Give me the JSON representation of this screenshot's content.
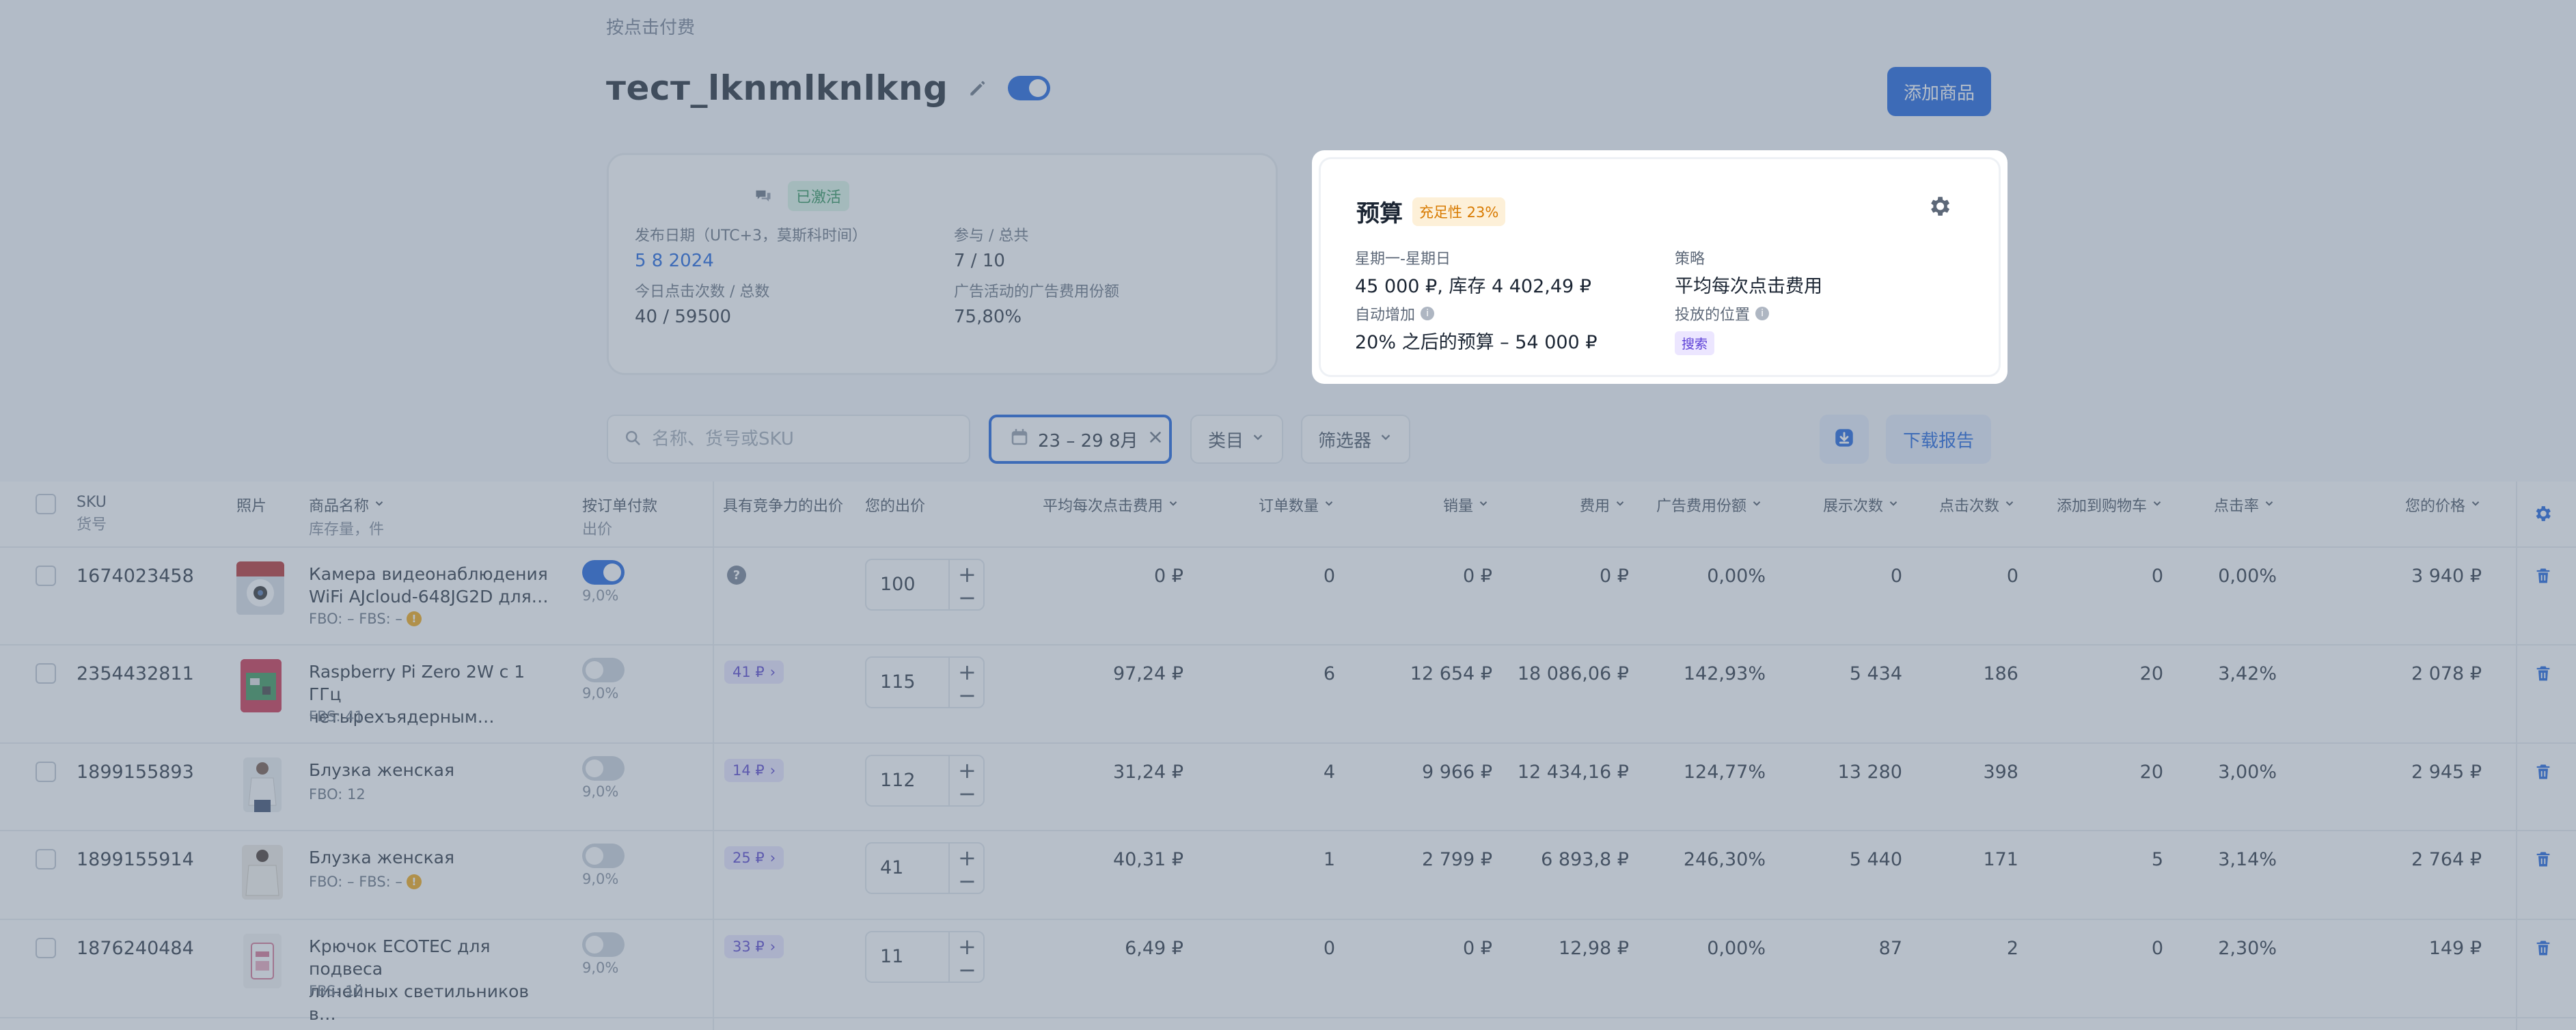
{
  "breadcrumb": "按点击付费",
  "campaign": {
    "title": "тест_lknmlknlkng",
    "enabled": true,
    "add_button": "添加商品",
    "status": "已激活",
    "start_label": "发布日期（UTC+3，莫斯科时间）",
    "start_value": "5 8 2024",
    "participate_label": "参与 / 总共",
    "participate_value": "7 / 10",
    "clicks_label": "今日点击次数 / 总数",
    "clicks_value": "40 / 59500",
    "ad_share_label": "广告活动的广告费用份额",
    "ad_share_value": "75,80%"
  },
  "budget": {
    "title": "预算",
    "badge": "充足性 23%",
    "period_label": "星期一-星期日",
    "period_value": "45 000 ₽, 库存 4 402,49 ₽",
    "strategy_label": "策略",
    "strategy_value": "平均每次点击费用",
    "auto_label": "自动增加",
    "auto_value": "20% 之后的预算 – 54 000 ₽",
    "placement_label": "投放的位置",
    "placement_value": "搜索"
  },
  "filters": {
    "search_placeholder": "名称、货号或SKU",
    "date_range": "23 – 29 8月",
    "category": "类目",
    "filter": "筛选器",
    "download": "下载报告"
  },
  "table": {
    "headers": {
      "sku": "SKU",
      "sku_sub": "货号",
      "photo": "照片",
      "name": "商品名称",
      "name_sub": "库存量，件",
      "pay_per_order": "按订单付款",
      "pay_sub": "出价",
      "competitive": "具有竞争力的出价",
      "your_bid": "您的出价",
      "avg_cpc": "平均每次点击费用",
      "orders": "订单数量",
      "sales": "销量",
      "cost": "费用",
      "ad_share": "广告费用份额",
      "impressions": "展示次数",
      "clicks": "点击次数",
      "add_to_cart": "添加到购物车",
      "ctr": "点击率",
      "your_price": "您的价格"
    },
    "rows": [
      {
        "sku": "1674023458",
        "name1": "Камера видеонаблюдения",
        "name2": "WiFi AJcloud-648JG2D для…",
        "stock": "FBO: –   FBS: –",
        "warn": true,
        "toggle": true,
        "pct": "9,0%",
        "competitive": "",
        "bid": "100",
        "avg_cpc": "0 ₽",
        "orders": "0",
        "sales": "0 ₽",
        "cost": "0 ₽",
        "ad_share": "0,00%",
        "impressions": "0",
        "clicks": "0",
        "cart": "0",
        "ctr": "0,00%",
        "price": "3 940 ₽"
      },
      {
        "sku": "2354432811",
        "name1": "Raspberry Pi Zero 2W с 1 ГГц",
        "name2": "четырехъядерным…",
        "stock": "FBS: 41",
        "warn": false,
        "toggle": false,
        "pct": "9,0%",
        "competitive": "41 ₽",
        "bid": "115",
        "avg_cpc": "97,24 ₽",
        "orders": "6",
        "sales": "12 654 ₽",
        "cost": "18 086,06 ₽",
        "ad_share": "142,93%",
        "impressions": "5 434",
        "clicks": "186",
        "cart": "20",
        "ctr": "3,42%",
        "price": "2 078 ₽"
      },
      {
        "sku": "1899155893",
        "name1": "Блузка женская",
        "name2": "",
        "stock": "FBO: 12",
        "warn": false,
        "toggle": false,
        "pct": "9,0%",
        "competitive": "14 ₽",
        "bid": "112",
        "avg_cpc": "31,24 ₽",
        "orders": "4",
        "sales": "9 966 ₽",
        "cost": "12 434,16 ₽",
        "ad_share": "124,77%",
        "impressions": "13 280",
        "clicks": "398",
        "cart": "20",
        "ctr": "3,00%",
        "price": "2 945 ₽"
      },
      {
        "sku": "1899155914",
        "name1": "Блузка женская",
        "name2": "",
        "stock": "FBO: –   FBS: –",
        "warn": true,
        "toggle": false,
        "pct": "9,0%",
        "competitive": "25 ₽",
        "bid": "41",
        "avg_cpc": "40,31 ₽",
        "orders": "1",
        "sales": "2 799 ₽",
        "cost": "6 893,8 ₽",
        "ad_share": "246,30%",
        "impressions": "5 440",
        "clicks": "171",
        "cart": "5",
        "ctr": "3,14%",
        "price": "2 764 ₽"
      },
      {
        "sku": "1876240484",
        "name1": "Крючок ECOTEC для подвеса",
        "name2": "линейных светильников в…",
        "stock": "FBS: 10",
        "warn": false,
        "toggle": false,
        "pct": "9,0%",
        "competitive": "33 ₽",
        "bid": "11",
        "avg_cpc": "6,49 ₽",
        "orders": "0",
        "sales": "0 ₽",
        "cost": "12,98 ₽",
        "ad_share": "0,00%",
        "impressions": "87",
        "clicks": "2",
        "cart": "0",
        "ctr": "2,30%",
        "price": "149 ₽"
      }
    ]
  },
  "colors": {
    "primary": "#0a56db",
    "overlay": "#708094",
    "success": "#1c8a4d",
    "warning": "#d87a00"
  }
}
